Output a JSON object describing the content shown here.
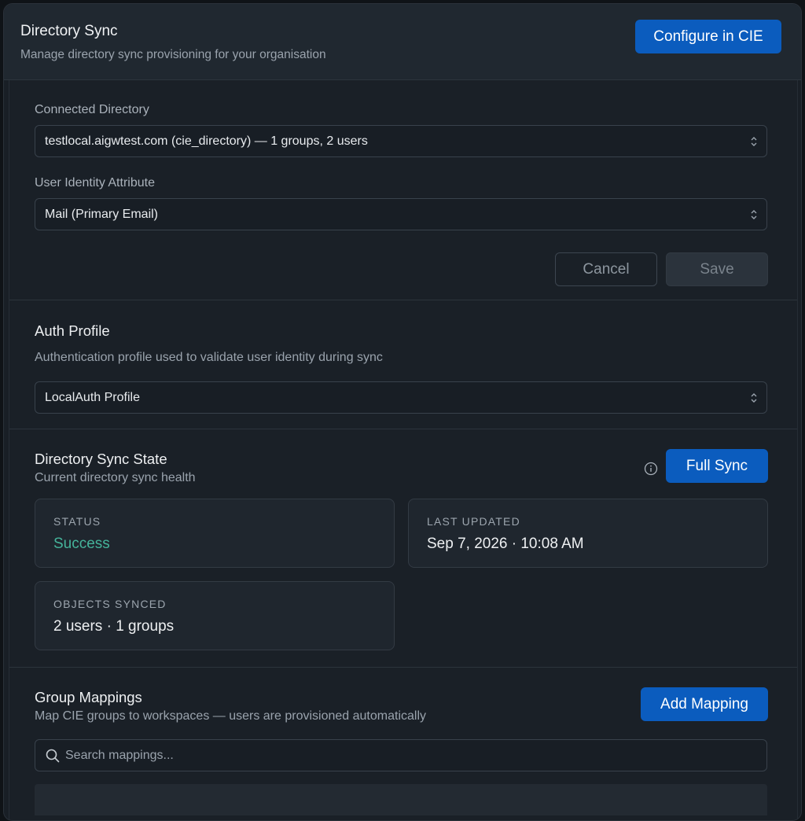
{
  "header": {
    "title": "Directory Sync",
    "subtitle": "Manage directory sync provisioning for your organisation",
    "configure_label": "Configure in CIE"
  },
  "connection": {
    "directory_label": "Connected Directory",
    "directory_value": "testlocal.aigwtest.com (cie_directory) — 1 groups, 2 users",
    "identity_label": "User Identity Attribute",
    "identity_value": "Mail (Primary Email)",
    "cancel_label": "Cancel",
    "save_label": "Save"
  },
  "auth_profile": {
    "title": "Auth Profile",
    "description": "Authentication profile used to validate user identity during sync",
    "value": "LocalAuth Profile"
  },
  "sync_state": {
    "title": "Directory Sync State",
    "subtitle": "Current directory sync health",
    "full_sync_label": "Full Sync",
    "info_icon": "info-circle-icon",
    "status_key": "STATUS",
    "status_value": "Success",
    "last_updated_key": "LAST UPDATED",
    "last_updated_value": "Sep 7, 2026 · 10:08 AM",
    "objects_key": "OBJECTS SYNCED",
    "objects_value": "2 users · 1 groups"
  },
  "group_mappings": {
    "title": "Group Mappings",
    "subtitle": "Map CIE groups to workspaces — users are provisioned automatically",
    "add_label": "Add Mapping",
    "search_placeholder": "Search mappings...",
    "search_icon": "search-icon"
  },
  "colors": {
    "accent": "#0b5cbe",
    "success": "#45b39a",
    "background": "#1a2027"
  }
}
